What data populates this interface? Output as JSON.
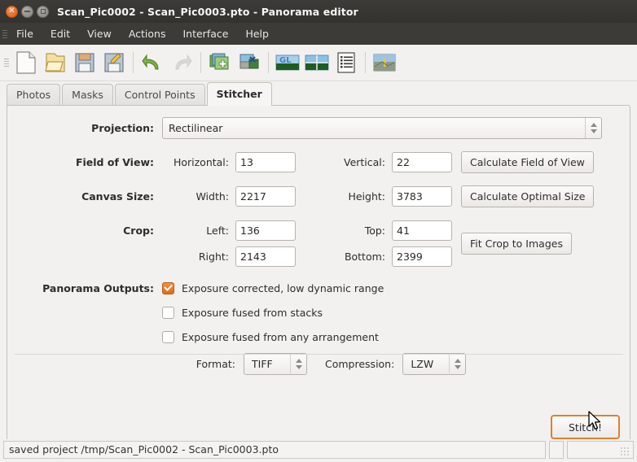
{
  "window": {
    "title": "Scan_Pic0002 - Scan_Pic0003.pto - Panorama editor",
    "controls": {
      "close": "×",
      "minimize": "minimize",
      "maximize": "maximize"
    }
  },
  "menu": {
    "items": [
      "File",
      "Edit",
      "View",
      "Actions",
      "Interface",
      "Help"
    ]
  },
  "toolbar": {
    "items": [
      {
        "name": "new-project-icon",
        "tooltip": "New"
      },
      {
        "name": "open-project-icon",
        "tooltip": "Open"
      },
      {
        "name": "save-project-icon",
        "tooltip": "Save"
      },
      {
        "name": "save-as-project-icon",
        "tooltip": "Save As"
      },
      {
        "name": "undo-icon",
        "tooltip": "Undo"
      },
      {
        "name": "redo-icon",
        "tooltip": "Redo"
      },
      {
        "name": "add-images-icon",
        "tooltip": "Add images"
      },
      {
        "name": "remove-images-icon",
        "tooltip": "Remove images"
      },
      {
        "name": "gl-preview-icon",
        "tooltip": "GL preview"
      },
      {
        "name": "preview-panorama-icon",
        "tooltip": "Preview panorama"
      },
      {
        "name": "show-log-icon",
        "tooltip": "Show log"
      },
      {
        "name": "fine-tune-icon",
        "tooltip": "Fine tune"
      }
    ]
  },
  "tabs": {
    "items": [
      "Photos",
      "Masks",
      "Control Points",
      "Stitcher"
    ],
    "active": "Stitcher"
  },
  "stitcher": {
    "projection": {
      "label": "Projection:",
      "value": "Rectilinear"
    },
    "field_of_view": {
      "label": "Field of View:",
      "horizontal_label": "Horizontal:",
      "horizontal_value": "13",
      "vertical_label": "Vertical:",
      "vertical_value": "22",
      "button": "Calculate Field of View"
    },
    "canvas_size": {
      "label": "Canvas Size:",
      "width_label": "Width:",
      "width_value": "2217",
      "height_label": "Height:",
      "height_value": "3783",
      "button": "Calculate Optimal Size"
    },
    "crop": {
      "label": "Crop:",
      "left_label": "Left:",
      "left_value": "136",
      "top_label": "Top:",
      "top_value": "41",
      "right_label": "Right:",
      "right_value": "2143",
      "bottom_label": "Bottom:",
      "bottom_value": "2399",
      "button": "Fit Crop to Images"
    },
    "panorama_outputs": {
      "label": "Panorama Outputs:",
      "options": [
        {
          "label": "Exposure corrected, low dynamic range",
          "checked": true
        },
        {
          "label": "Exposure fused from stacks",
          "checked": false
        },
        {
          "label": "Exposure fused from any arrangement",
          "checked": false
        }
      ],
      "format_label": "Format:",
      "format_value": "TIFF",
      "compression_label": "Compression:",
      "compression_value": "LZW"
    },
    "stitch_button": "Stitch!"
  },
  "statusbar": {
    "message": "saved project /tmp/Scan_Pic0002 - Scan_Pic0003.pto"
  },
  "colors": {
    "accent_orange": "#e0802c",
    "checkbox_checked": "#dd6e1e",
    "titlebar": "#3c3b37",
    "panel_bg": "#f2f1f0"
  }
}
